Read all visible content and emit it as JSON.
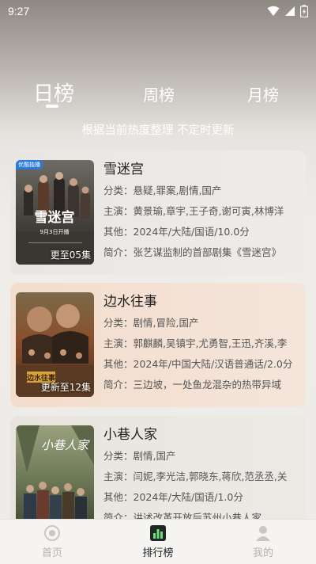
{
  "status": {
    "time": "9:27"
  },
  "tabs": [
    {
      "label": "日榜"
    },
    {
      "label": "周榜"
    },
    {
      "label": "月榜"
    }
  ],
  "subtitle": "根据当前热度整理 不定时更新",
  "items": [
    {
      "title": "雪迷宫",
      "genre": "分类：悬疑,罪案,剧情,国产",
      "cast": "主演：黄景瑜,章宇,王子奇,谢可寅,林博洋",
      "other": "其他：2024年/大陆/国语/10.0分",
      "summary": "简介：张艺谋监制的首部剧集《雪迷宫》",
      "badge": "更至05集",
      "poster_tag": "优酷独播",
      "poster_title": "雪迷宫",
      "poster_date": "9月3日开播"
    },
    {
      "title": "边水往事",
      "genre": "分类：剧情,冒险,国产",
      "cast": "主演：郭麒麟,吴镇宇,尤勇智,王迅,齐溪,李",
      "other": "其他：2024年/中国大陆/汉语普通话/2.0分",
      "summary": "简介：三边坡，一处鱼龙混杂的热带异域",
      "badge": "更新至12集",
      "poster_title": "边水往事"
    },
    {
      "title": "小巷人家",
      "genre": "分类：剧情,国产",
      "cast": "主演：闫妮,李光洁,郭晓东,蒋欣,范丞丞,关",
      "other": "其他：2024年/大陆/国语/1.0分",
      "summary": "简介：讲述改革开放后苏州小巷人家",
      "poster_title": "小巷人家"
    }
  ],
  "nav": [
    {
      "label": "首页"
    },
    {
      "label": "排行榜"
    },
    {
      "label": "我的"
    }
  ]
}
